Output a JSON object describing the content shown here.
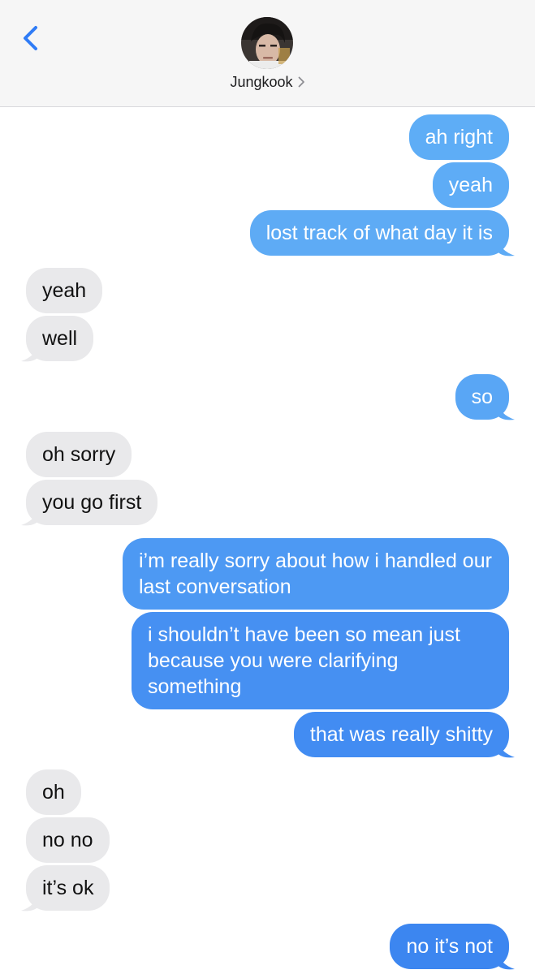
{
  "header": {
    "contact_name": "Jungkook",
    "back_icon": "chevron-left-icon",
    "avatar": "contact-avatar"
  },
  "colors": {
    "outgoing_top": "#5aaaf4",
    "outgoing_bottom": "#3c86f0",
    "incoming": "#e9e9eb",
    "ios_blue": "#2f7cf6"
  },
  "messages": [
    {
      "side": "out",
      "text": "ah right"
    },
    {
      "side": "out",
      "text": "yeah"
    },
    {
      "side": "out",
      "text": "lost track of what day it is"
    },
    {
      "side": "in",
      "text": "yeah"
    },
    {
      "side": "in",
      "text": "well"
    },
    {
      "side": "out",
      "text": "so"
    },
    {
      "side": "in",
      "text": "oh sorry"
    },
    {
      "side": "in",
      "text": "you go first"
    },
    {
      "side": "out",
      "text": "i’m really sorry about how i handled our last conversation"
    },
    {
      "side": "out",
      "text": "i shouldn’t have been so mean just because you were clarifying something"
    },
    {
      "side": "out",
      "text": "that was really shitty"
    },
    {
      "side": "in",
      "text": "oh"
    },
    {
      "side": "in",
      "text": "no no"
    },
    {
      "side": "in",
      "text": "it’s ok"
    },
    {
      "side": "out",
      "text": "no it’s not"
    }
  ]
}
